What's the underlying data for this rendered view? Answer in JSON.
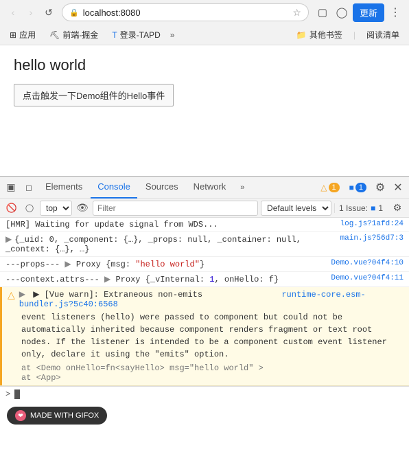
{
  "browser": {
    "back_btn": "‹",
    "forward_btn": "›",
    "reload_btn": "↺",
    "address": "localhost:8080",
    "lock_icon": "🔒",
    "star_icon": "☆",
    "bookmark_icon": "⊞",
    "bookmarks": [
      {
        "icon": "⊞",
        "label": "应用"
      },
      {
        "icon": "⛏",
        "label": "前端-掘金"
      },
      {
        "icon": "T",
        "label": "登录-TAPD"
      }
    ],
    "more_bookmarks": "»",
    "other_bookmarks": "其他书签",
    "read_mode": "阅读清单",
    "update_btn": "更新",
    "menu_icon": "⋮",
    "cast_icon": "⊡",
    "profile_icon": "○"
  },
  "page": {
    "title": "hello world",
    "button_label": "点击触发一下Demo组件的Hello事件"
  },
  "devtools": {
    "tabs": [
      "Elements",
      "Console",
      "Sources",
      "Network"
    ],
    "active_tab": "Console",
    "more_tabs": "»",
    "warn_count": "1",
    "info_count": "1",
    "settings_icon": "⚙",
    "close_icon": "✕",
    "inspect_icon": "⬚",
    "device_icon": "⊡",
    "console_toolbar": {
      "clear_icon": "🚫",
      "filter_placeholder": "Filter",
      "top_label": "top",
      "eye_icon": "👁",
      "levels_label": "Default levels",
      "issues_label": "1 Issue:",
      "issues_count": "1",
      "settings_icon": "⚙"
    },
    "console_lines": [
      {
        "type": "log",
        "content": "[HMR] Waiting for update signal from WDS...",
        "source": "log.js?1afd:24"
      },
      {
        "type": "log",
        "expandable": true,
        "content": "{_uid: 0, _component: {…}, _props: null, _container: null, _context:",
        "content2": "{…}, …}",
        "source": "main.js?56d7:3"
      },
      {
        "type": "log",
        "content": "---props---  ▶ Proxy {msg: \"hello world\"}",
        "source": "Demo.vue?04f4:10"
      },
      {
        "type": "log",
        "content": "---context.attrs---  ▶ Proxy {_vInternal: 1, onHello: f}",
        "source": "Demo.vue?04f4:11"
      }
    ],
    "warning": {
      "icon": "⚠",
      "header_prefix": "▶ [Vue warn]: Extraneous non-emits",
      "header_link": "runtime-core.esm-bundler.js?5c40:6568",
      "body_line1": "event listeners (hello) were passed to component but could not be",
      "body_line2": "automatically inherited because component renders fragment or text root",
      "body_line3": "nodes. If the listener is intended to be a component custom event listener",
      "body_line4": "only, declare it using the \"emits\" option.",
      "stack_line1": "  at <Demo onHello=fn<sayHello> msg=\"hello world\" >",
      "stack_line2": "  at <App>"
    },
    "console_prompt": ">"
  },
  "footer": {
    "icon": "❤",
    "label": "MADE WITH GIFOX"
  }
}
